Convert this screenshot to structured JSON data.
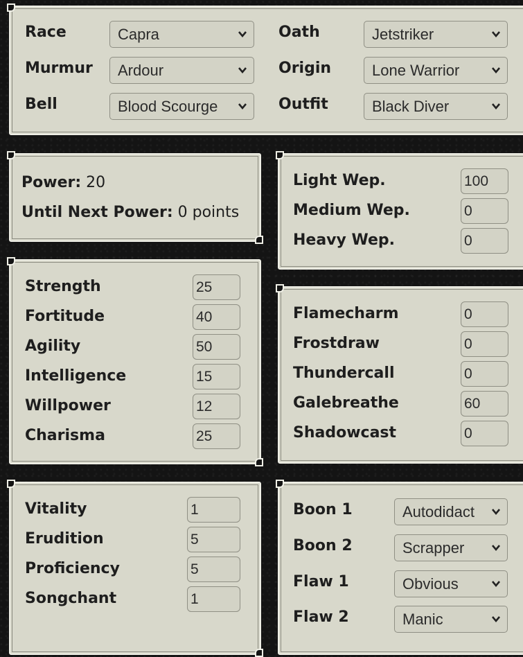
{
  "character": {
    "race": {
      "label": "Race",
      "value": "Capra"
    },
    "oath": {
      "label": "Oath",
      "value": "Jetstriker"
    },
    "murmur": {
      "label": "Murmur",
      "value": "Ardour"
    },
    "origin": {
      "label": "Origin",
      "value": "Lone Warrior"
    },
    "bell": {
      "label": "Bell",
      "value": "Blood Scourge"
    },
    "outfit": {
      "label": "Outfit",
      "value": "Black Diver"
    }
  },
  "power": {
    "power_label": "Power:",
    "power_value": "20",
    "next_label": "Until Next Power:",
    "next_value": "0 points"
  },
  "weapons": [
    {
      "label": "Light Wep.",
      "value": "100"
    },
    {
      "label": "Medium Wep.",
      "value": "0"
    },
    {
      "label": "Heavy Wep.",
      "value": "0"
    }
  ],
  "attributes": [
    {
      "label": "Strength",
      "value": "25"
    },
    {
      "label": "Fortitude",
      "value": "40"
    },
    {
      "label": "Agility",
      "value": "50"
    },
    {
      "label": "Intelligence",
      "value": "15"
    },
    {
      "label": "Willpower",
      "value": "12"
    },
    {
      "label": "Charisma",
      "value": "25"
    }
  ],
  "attunements": [
    {
      "label": "Flamecharm",
      "value": "0"
    },
    {
      "label": "Frostdraw",
      "value": "0"
    },
    {
      "label": "Thundercall",
      "value": "0"
    },
    {
      "label": "Galebreathe",
      "value": "60"
    },
    {
      "label": "Shadowcast",
      "value": "0"
    }
  ],
  "investments": [
    {
      "label": "Vitality",
      "value": "1"
    },
    {
      "label": "Erudition",
      "value": "5"
    },
    {
      "label": "Proficiency",
      "value": "5"
    },
    {
      "label": "Songchant",
      "value": "1"
    }
  ],
  "traits": [
    {
      "label": "Boon 1",
      "value": "Autodidact"
    },
    {
      "label": "Boon 2",
      "value": "Scrapper"
    },
    {
      "label": "Flaw 1",
      "value": "Obvious"
    },
    {
      "label": "Flaw 2",
      "value": "Manic"
    }
  ]
}
